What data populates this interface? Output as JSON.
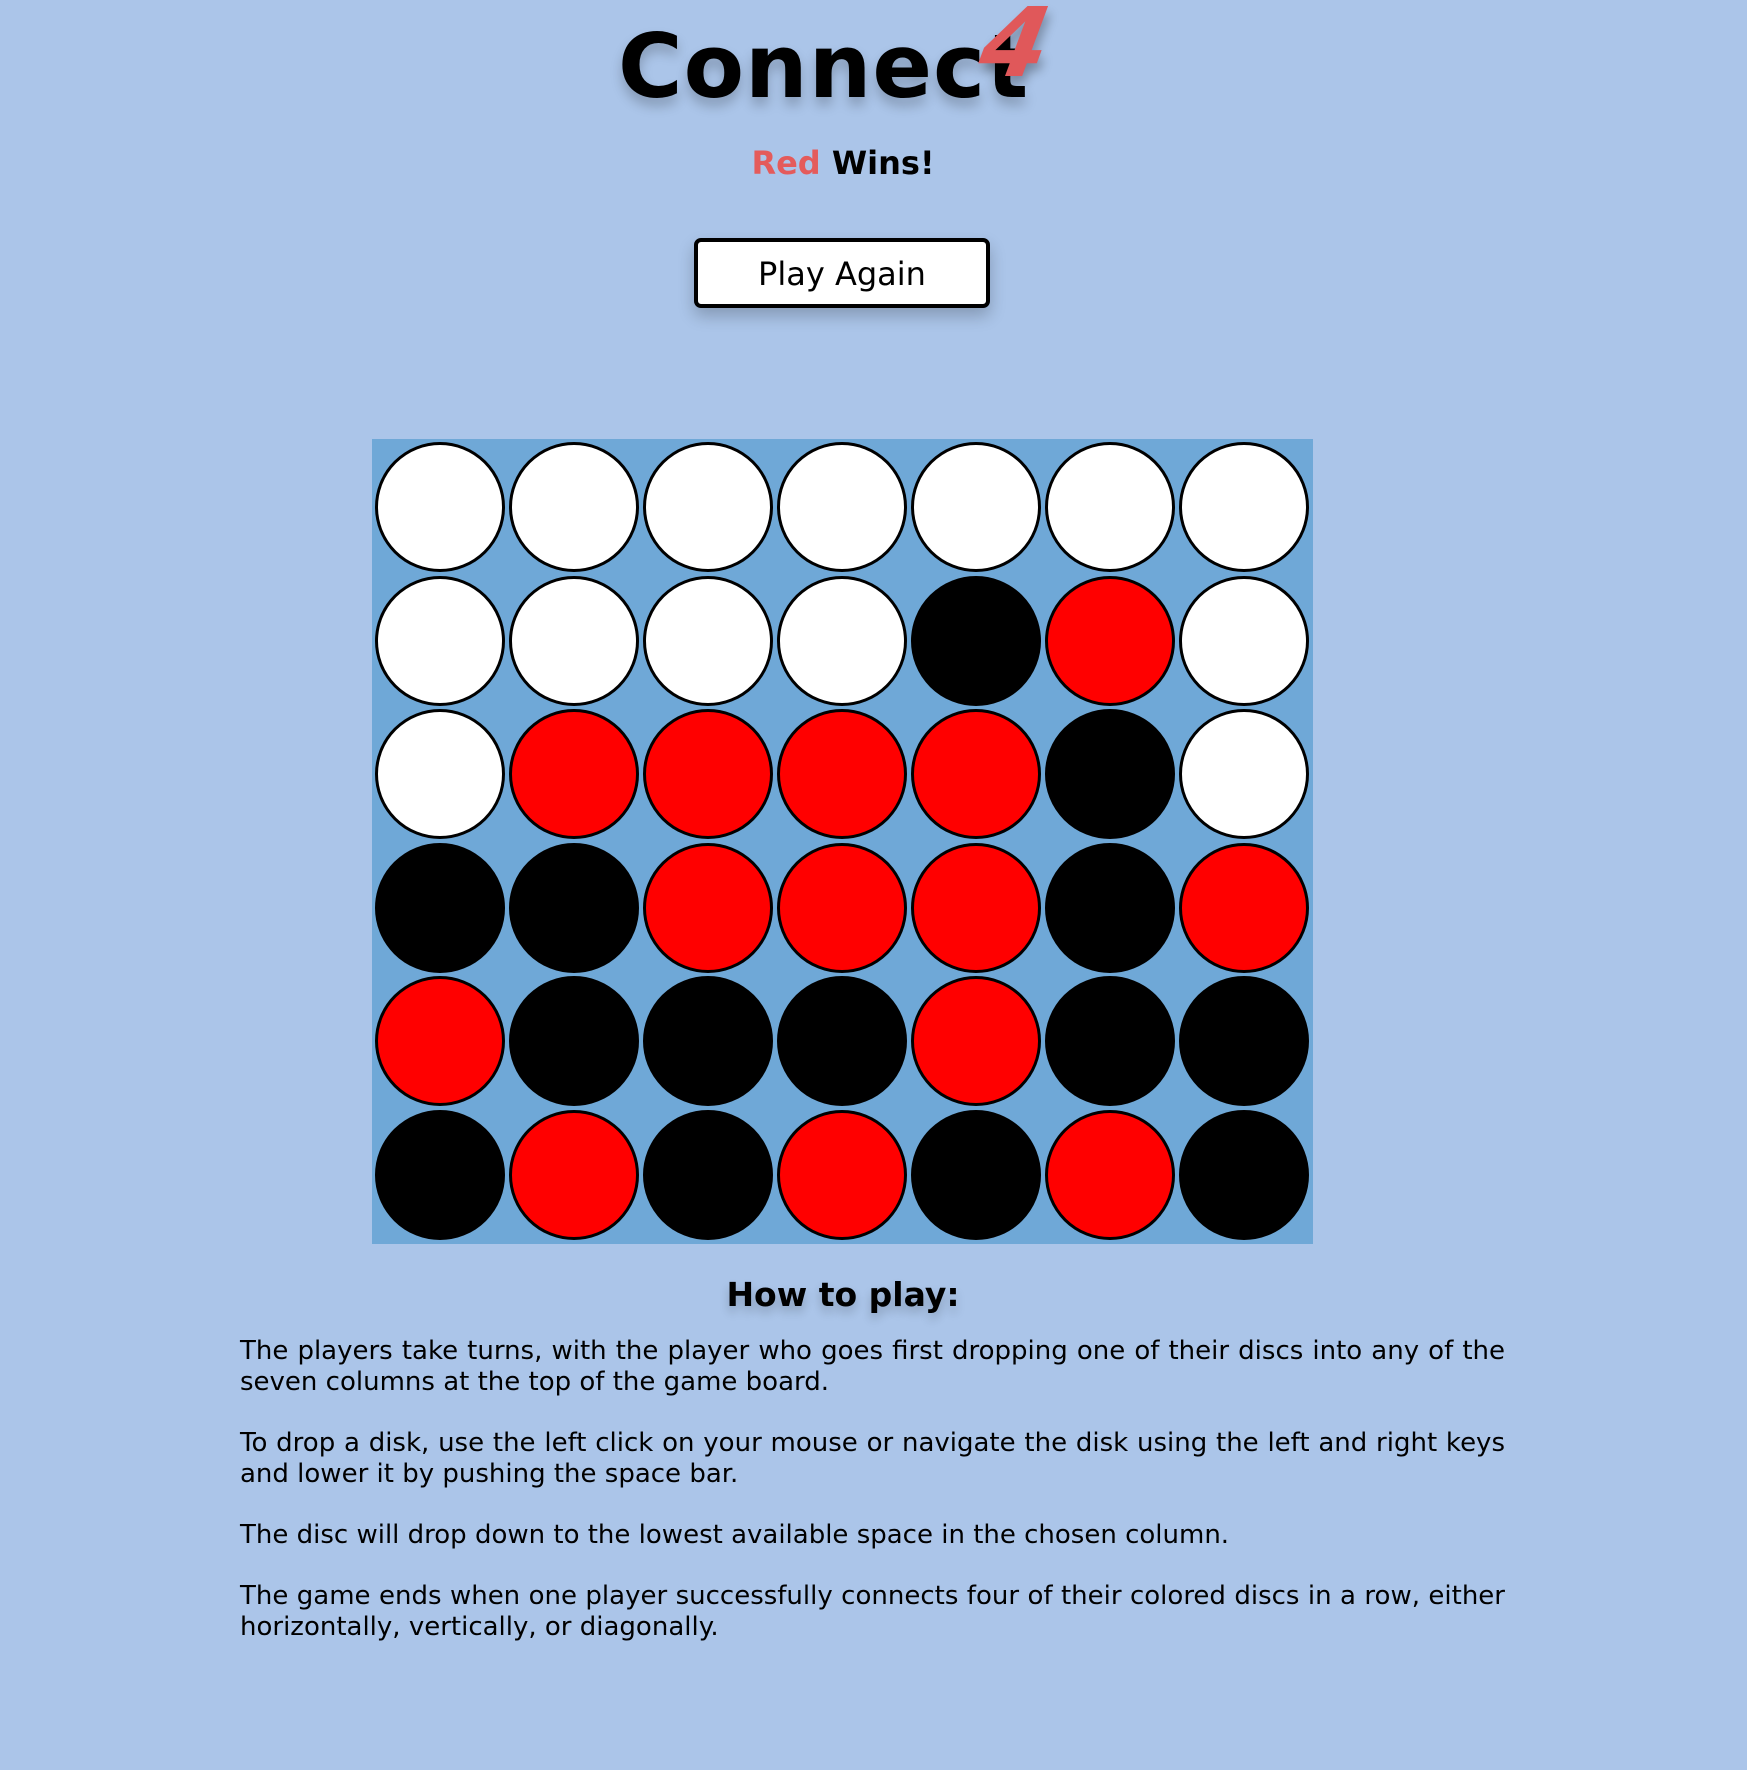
{
  "header": {
    "title": "Connect",
    "title_number": "4"
  },
  "status": {
    "winner": "Red",
    "suffix": "Wins!"
  },
  "controls": {
    "play_again_label": "Play Again"
  },
  "board": {
    "rows": 6,
    "columns": 7,
    "cells": [
      [
        "empty",
        "empty",
        "empty",
        "empty",
        "empty",
        "empty",
        "empty"
      ],
      [
        "empty",
        "empty",
        "empty",
        "empty",
        "black",
        "red",
        "empty"
      ],
      [
        "empty",
        "red",
        "red",
        "red",
        "red",
        "black",
        "empty"
      ],
      [
        "black",
        "black",
        "red",
        "red",
        "red",
        "black",
        "red"
      ],
      [
        "red",
        "black",
        "black",
        "black",
        "red",
        "black",
        "black"
      ],
      [
        "black",
        "red",
        "black",
        "red",
        "black",
        "red",
        "black"
      ]
    ]
  },
  "how_to_play": {
    "heading": "How to play:",
    "paragraphs": [
      "The players take turns, with the player who goes first dropping one of their discs into any of the seven columns at the top of the game board.",
      "To drop a disk, use the left click on your mouse or navigate the disk using the left and right keys and lower it by pushing the space bar.",
      "The disc will drop down to the lowest available space in the chosen column.",
      "The game ends when one player successfully connects four of their colored discs in a row, either horizontally, vertically, or diagonally."
    ]
  },
  "colors": {
    "background": "#abc5e9",
    "board": "#6fa8d7",
    "red_disc": "#ff0000",
    "black_disc": "#000000",
    "empty_slot": "#ffffff",
    "accent_red": "#e45b5b"
  }
}
